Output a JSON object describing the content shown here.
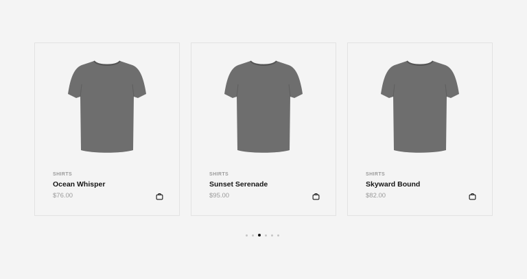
{
  "products": [
    {
      "category": "SHIRTS",
      "title": "Ocean Whisper",
      "price": "$76.00",
      "image": "tshirt-image",
      "color": "#6e6e6e"
    },
    {
      "category": "SHIRTS",
      "title": "Sunset Serenade",
      "price": "$95.00",
      "image": "tshirt-image",
      "color": "#6e6e6e"
    },
    {
      "category": "SHIRTS",
      "title": "Skyward Bound",
      "price": "$82.00",
      "image": "tshirt-image",
      "color": "#6e6e6e"
    }
  ],
  "cart_icon": "shopping-bag-icon",
  "pagination": {
    "total": 6,
    "active_index": 2
  },
  "colors": {
    "background": "#f4f4f4",
    "border": "#e2e2e2",
    "muted_text": "#9a9a9a",
    "title_text": "#151515",
    "active_dot": "#111111",
    "inactive_dot": "#c4c4c4"
  }
}
